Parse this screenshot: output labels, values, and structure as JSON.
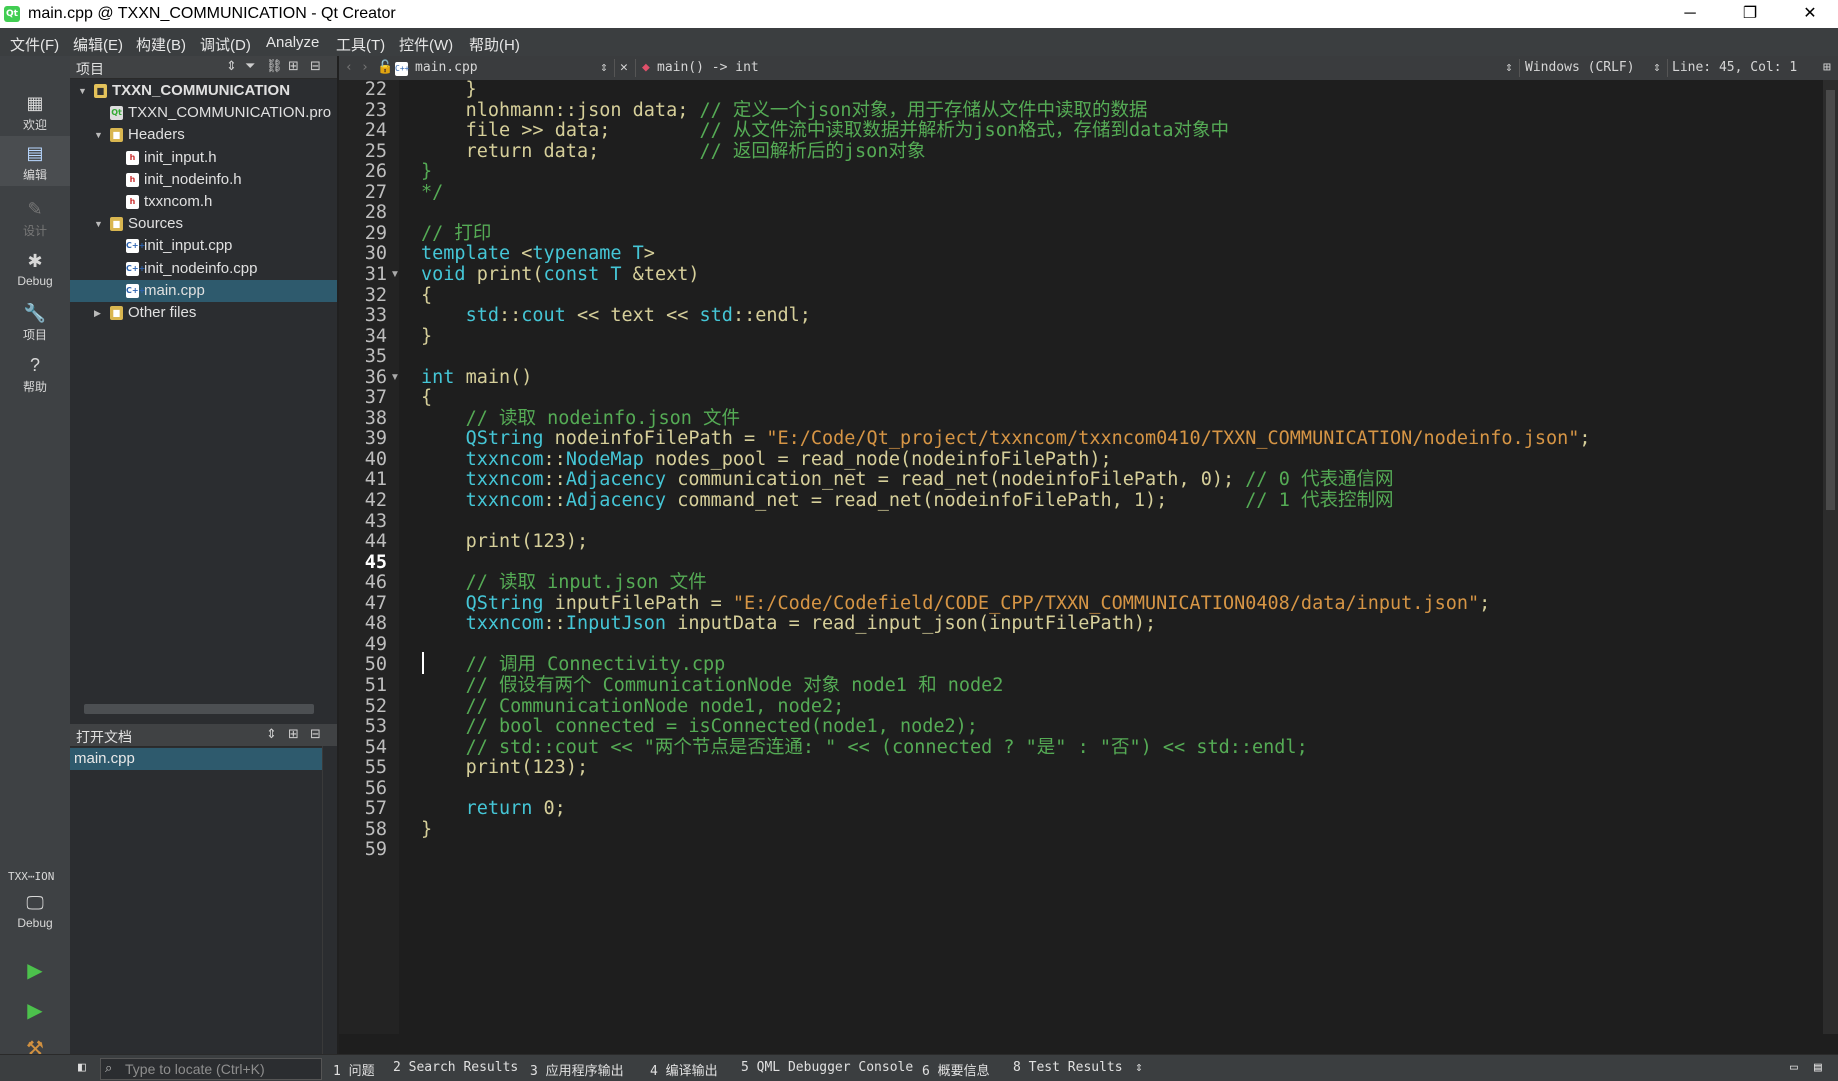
{
  "window": {
    "title": "main.cpp @ TXXN_COMMUNICATION - Qt Creator",
    "app_icon_text": "Qt",
    "minimize": "─",
    "maximize": "❐",
    "close": "✕"
  },
  "menu": [
    "文件(F)",
    "编辑(E)",
    "构建(B)",
    "调试(D)",
    "Analyze",
    "工具(T)",
    "控件(W)",
    "帮助(H)"
  ],
  "modes": [
    {
      "label": "欢迎",
      "icon": "▦"
    },
    {
      "label": "编辑",
      "icon": "▤"
    },
    {
      "label": "设计",
      "icon": "✎"
    },
    {
      "label": "Debug",
      "icon": "✱"
    },
    {
      "label": "项目",
      "icon": "🔧"
    },
    {
      "label": "帮助",
      "icon": "?"
    }
  ],
  "kit": {
    "name": "TXX⋯ION",
    "build": "Debug"
  },
  "projects": {
    "title": "项目",
    "tree": [
      {
        "label": "TXXN_COMMUNICATION",
        "depth": 0,
        "arrow": "▼",
        "icon": "proj",
        "bold": true
      },
      {
        "label": "TXXN_COMMUNICATION.pro",
        "depth": 1,
        "arrow": "",
        "icon": "pro"
      },
      {
        "label": "Headers",
        "depth": 1,
        "arrow": "▼",
        "icon": "folder"
      },
      {
        "label": "init_input.h",
        "depth": 2,
        "arrow": "",
        "icon": "h"
      },
      {
        "label": "init_nodeinfo.h",
        "depth": 2,
        "arrow": "",
        "icon": "h"
      },
      {
        "label": "txxncom.h",
        "depth": 2,
        "arrow": "",
        "icon": "h"
      },
      {
        "label": "Sources",
        "depth": 1,
        "arrow": "▼",
        "icon": "folder"
      },
      {
        "label": "init_input.cpp",
        "depth": 2,
        "arrow": "",
        "icon": "cpp"
      },
      {
        "label": "init_nodeinfo.cpp",
        "depth": 2,
        "arrow": "",
        "icon": "cpp"
      },
      {
        "label": "main.cpp",
        "depth": 2,
        "arrow": "",
        "icon": "cpp",
        "selected": true
      },
      {
        "label": "Other files",
        "depth": 1,
        "arrow": "▶",
        "icon": "folder"
      }
    ]
  },
  "open_documents": {
    "title": "打开文档",
    "items": [
      "main.cpp"
    ]
  },
  "editor_toolbar": {
    "file": "main.cpp",
    "symbol": "main() -> int",
    "line_ending": "Windows (CRLF)",
    "position": "Line: 45, Col: 1"
  },
  "editor": {
    "current_line": 45,
    "lines": [
      {
        "n": 22,
        "fold": "",
        "html": "    }"
      },
      {
        "n": 23,
        "fold": "",
        "html": "    <span class=\"var\">nlohmann</span>::<span class=\"var\">json</span> <span class=\"var\">data</span>; <span class=\"cmz\">// 定义一个json对象，用于存储从文件中读取的数据</span>"
      },
      {
        "n": 24,
        "fold": "",
        "html": "    <span class=\"var\">file</span> >> <span class=\"var\">data</span>;        <span class=\"cmz\">// 从文件流中读取数据并解析为json格式，存储到data对象中</span>"
      },
      {
        "n": 25,
        "fold": "",
        "html": "    <span class=\"var\">return</span> <span class=\"var\">data</span>;         <span class=\"cmz\">// 返回解析后的json对象</span>"
      },
      {
        "n": 26,
        "fold": "",
        "html": "<span class=\"cmz\">}</span>"
      },
      {
        "n": 27,
        "fold": "",
        "html": "<span class=\"cmz\">*/</span>"
      },
      {
        "n": 28,
        "fold": "",
        "html": ""
      },
      {
        "n": 29,
        "fold": "",
        "html": "<span class=\"cmz\">// 打印</span>"
      },
      {
        "n": 30,
        "fold": "",
        "html": "<span class=\"kw\">template</span> <<span class=\"kw\">typename</span> <span class=\"ns\">T</span>>"
      },
      {
        "n": 31,
        "fold": "▼",
        "html": "<span class=\"kw\">void</span> <span class=\"fn\">print</span>(<span class=\"kw\">const</span> <span class=\"ns\">T</span> &<span class=\"var\">text</span>)"
      },
      {
        "n": 32,
        "fold": "",
        "html": "{"
      },
      {
        "n": 33,
        "fold": "",
        "html": "    <span class=\"ns\">std</span>::<span class=\"ns\">cout</span> << <span class=\"var\">text</span> << <span class=\"ns\">std</span>::<span class=\"fn\">endl</span>;"
      },
      {
        "n": 34,
        "fold": "",
        "html": "}"
      },
      {
        "n": 35,
        "fold": "",
        "html": ""
      },
      {
        "n": 36,
        "fold": "▼",
        "html": "<span class=\"kw\">int</span> <span class=\"fn\">main</span>()"
      },
      {
        "n": 37,
        "fold": "",
        "html": "{"
      },
      {
        "n": 38,
        "fold": "",
        "html": "    <span class=\"cmz\">// 读取 nodeinfo.json 文件</span>"
      },
      {
        "n": 39,
        "fold": "",
        "html": "    <span class=\"tyq\">QString</span> <span class=\"var\">nodeinfoFilePath</span> = <span class=\"str\">\"E:/Code/Qt_project/txxncom/txxncom0410/TXXN_COMMUNICATION/nodeinfo.json\"</span>;"
      },
      {
        "n": 40,
        "fold": "",
        "html": "    <span class=\"ns\">txxncom</span>::<span class=\"tyq\">NodeMap</span> <span class=\"var\">nodes_pool</span> = <span class=\"fn\">read_node</span>(<span class=\"var\">nodeinfoFilePath</span>);"
      },
      {
        "n": 41,
        "fold": "",
        "html": "    <span class=\"ns\">txxncom</span>::<span class=\"tyq\">Adjacency</span> <span class=\"var\">communication_net</span> = <span class=\"fn\">read_net</span>(<span class=\"var\">nodeinfoFilePath</span>, <span class=\"num2\">0</span>); <span class=\"cmz\">// 0 代表通信网</span>"
      },
      {
        "n": 42,
        "fold": "",
        "html": "    <span class=\"ns\">txxncom</span>::<span class=\"tyq\">Adjacency</span> <span class=\"var\">command_net</span> = <span class=\"fn\">read_net</span>(<span class=\"var\">nodeinfoFilePath</span>, <span class=\"num2\">1</span>);       <span class=\"cmz\">// 1 代表控制网</span>"
      },
      {
        "n": 43,
        "fold": "",
        "html": ""
      },
      {
        "n": 44,
        "fold": "",
        "html": "    <span class=\"fn\">print</span>(<span class=\"num2\">123</span>);"
      },
      {
        "n": 45,
        "fold": "",
        "html": ""
      },
      {
        "n": 46,
        "fold": "",
        "html": "    <span class=\"cmz\">// 读取 input.json 文件</span>"
      },
      {
        "n": 47,
        "fold": "",
        "html": "    <span class=\"tyq\">QString</span> <span class=\"var\">inputFilePath</span> = <span class=\"str\">\"E:/Code/Codefield/CODE_CPP/TXXN_COMMUNICATION0408/data/input.json\"</span>;"
      },
      {
        "n": 48,
        "fold": "",
        "html": "    <span class=\"ns\">txxncom</span>::<span class=\"tyq\">InputJson</span> <span class=\"var\">inputData</span> = <span class=\"fn\">read_input_json</span>(<span class=\"var\">inputFilePath</span>);"
      },
      {
        "n": 49,
        "fold": "",
        "html": ""
      },
      {
        "n": 50,
        "fold": "",
        "html": "    <span class=\"cmz\">// 调用 Connectivity.cpp</span>"
      },
      {
        "n": 51,
        "fold": "",
        "html": "    <span class=\"cmz\">// 假设有两个 CommunicationNode 对象 node1 和 node2</span>"
      },
      {
        "n": 52,
        "fold": "",
        "html": "    <span class=\"cmz\">// CommunicationNode node1, node2;</span>"
      },
      {
        "n": 53,
        "fold": "",
        "html": "    <span class=\"cmz\">// bool connected = isConnected(node1, node2);</span>"
      },
      {
        "n": 54,
        "fold": "",
        "html": "    <span class=\"cmz\">// std::cout << \"两个节点是否连通: \" << (connected ? \"是\" : \"否\") << std::endl;</span>"
      },
      {
        "n": 55,
        "fold": "",
        "html": "    <span class=\"fn\">print</span>(<span class=\"num2\">123</span>);"
      },
      {
        "n": 56,
        "fold": "",
        "html": ""
      },
      {
        "n": 57,
        "fold": "",
        "html": "    <span class=\"kw\">return</span> <span class=\"num2\">0</span>;"
      },
      {
        "n": 58,
        "fold": "",
        "html": "}"
      },
      {
        "n": 59,
        "fold": "",
        "html": ""
      }
    ]
  },
  "statusbar": {
    "locator_placeholder": "Type to locate (Ctrl+K)",
    "panes": [
      "1 问题",
      "2 Search Results",
      "3 应用程序输出",
      "4 编译输出",
      "5 QML Debugger Console",
      "6 概要信息",
      "8 Test Results"
    ]
  }
}
